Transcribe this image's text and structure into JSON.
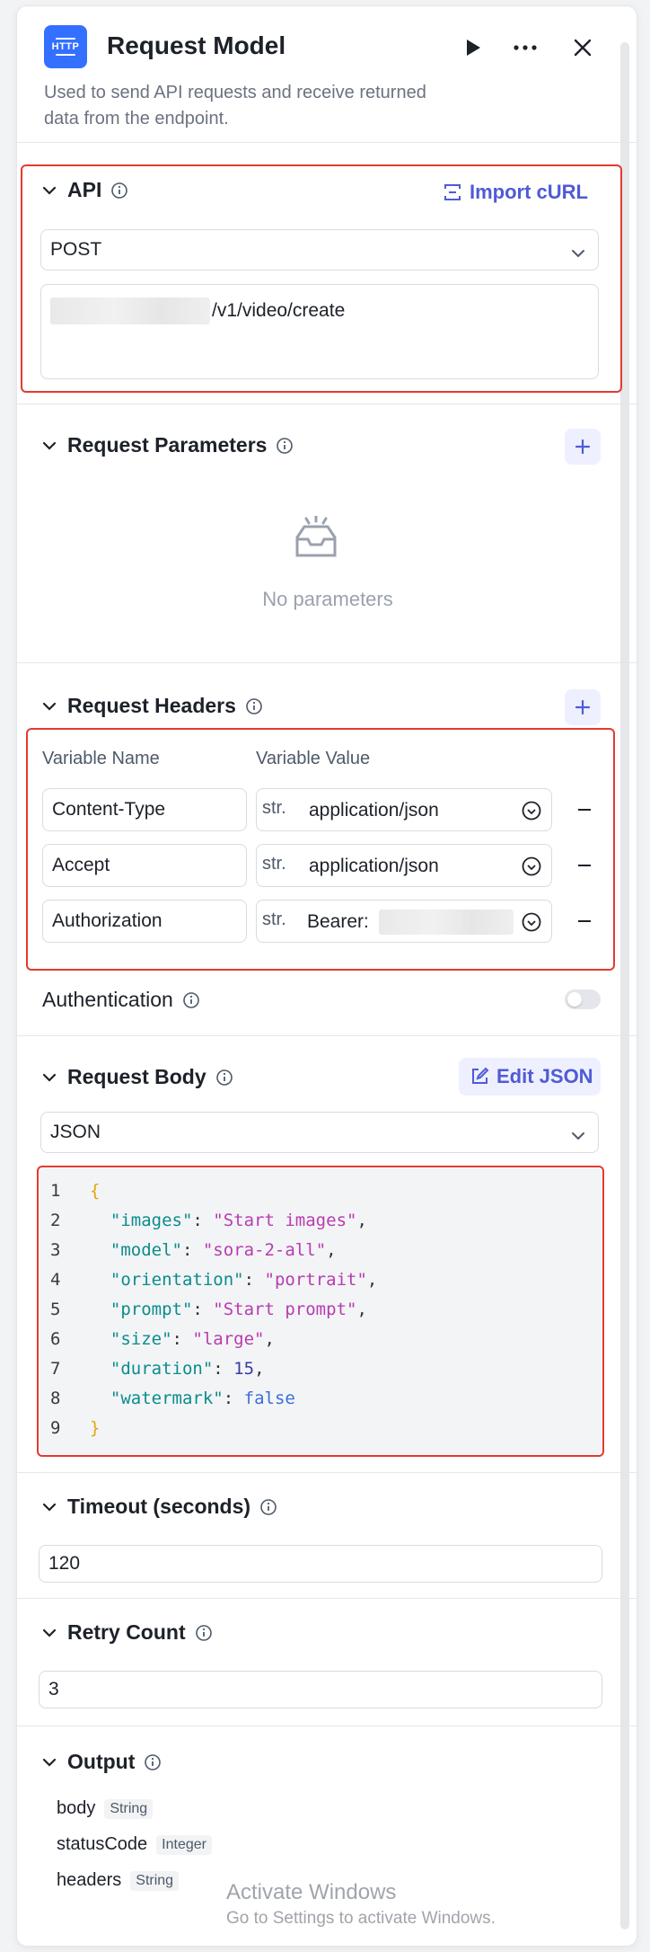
{
  "header": {
    "logo_text": "HTTP",
    "title": "Request Model",
    "description": "Used to send API requests and receive returned data from the endpoint."
  },
  "api": {
    "title": "API",
    "import_label": "Import cURL",
    "method": "POST",
    "url_suffix": "/v1/video/create"
  },
  "params": {
    "title": "Request Parameters",
    "empty_text": "No parameters"
  },
  "headers": {
    "title": "Request Headers",
    "col_name": "Variable Name",
    "col_value": "Variable Value",
    "rows": [
      {
        "name": "Content-Type",
        "type": "str.",
        "value": "application/json"
      },
      {
        "name": "Accept",
        "type": "str.",
        "value": "application/json"
      },
      {
        "name": "Authorization",
        "type": "str.",
        "value": "Bearer:"
      }
    ]
  },
  "auth": {
    "title": "Authentication"
  },
  "body": {
    "title": "Request Body",
    "edit_label": "Edit JSON",
    "format": "JSON",
    "line_numbers": [
      "1",
      "2",
      "3",
      "4",
      "5",
      "6",
      "7",
      "8",
      "9"
    ]
  },
  "timeout": {
    "title": "Timeout (seconds)",
    "value": "120"
  },
  "retry": {
    "title": "Retry Count",
    "value": "3"
  },
  "output": {
    "title": "Output",
    "fields": [
      {
        "name": "body",
        "type": "String"
      },
      {
        "name": "statusCode",
        "type": "Integer"
      },
      {
        "name": "headers",
        "type": "String"
      }
    ]
  },
  "watermark": {
    "line1": "Activate Windows",
    "line2": "Go to Settings to activate Windows."
  },
  "colors": {
    "accent": "#4f5bd5",
    "logo_blue": "#3370ff",
    "highlight_red": "#e33a2f"
  }
}
